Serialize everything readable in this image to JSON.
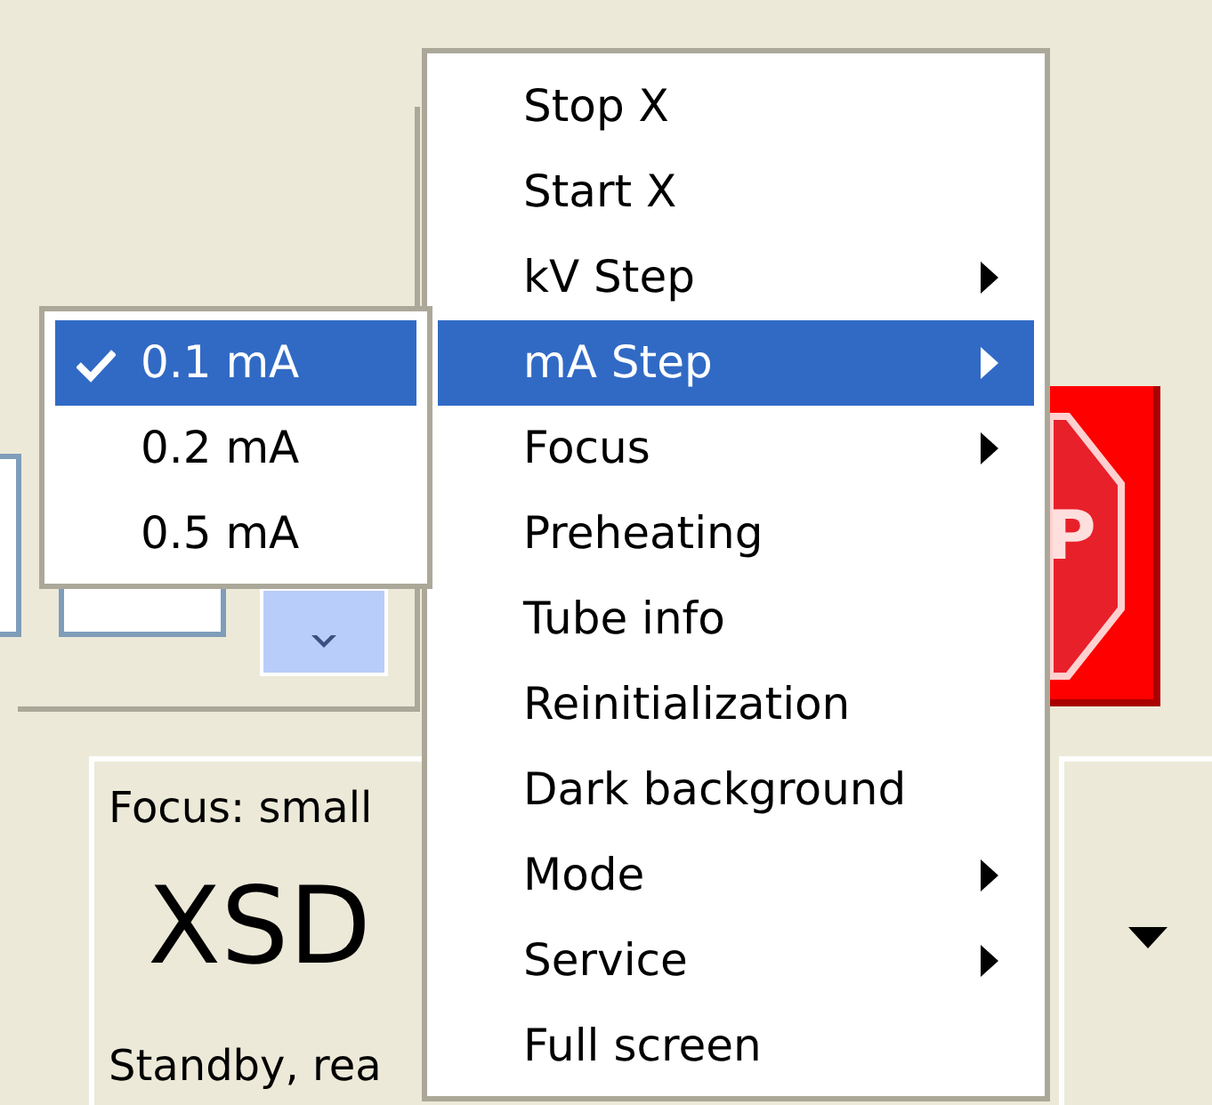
{
  "stop_button": {
    "label": "P"
  },
  "status_panel": {
    "focus": "Focus: small",
    "device": "XSD",
    "status": "Standby, rea"
  },
  "menu": {
    "items": [
      {
        "label": "Stop X",
        "submenu": false,
        "selected": false
      },
      {
        "label": "Start X",
        "submenu": false,
        "selected": false
      },
      {
        "label": "kV Step",
        "submenu": true,
        "selected": false
      },
      {
        "label": "mA Step",
        "submenu": true,
        "selected": true
      },
      {
        "label": "Focus",
        "submenu": true,
        "selected": false
      },
      {
        "label": "Preheating",
        "submenu": false,
        "selected": false
      },
      {
        "label": "Tube info",
        "submenu": false,
        "selected": false
      },
      {
        "label": "Reinitialization",
        "submenu": false,
        "selected": false
      },
      {
        "label": "Dark background",
        "submenu": false,
        "selected": false
      },
      {
        "label": "Mode",
        "submenu": true,
        "selected": false
      },
      {
        "label": "Service",
        "submenu": true,
        "selected": false
      },
      {
        "label": "Full screen",
        "submenu": false,
        "selected": false
      }
    ]
  },
  "submenu": {
    "items": [
      {
        "label": "0.1 mA",
        "checked": true,
        "selected": true
      },
      {
        "label": "0.2 mA",
        "checked": false,
        "selected": false
      },
      {
        "label": "0.5 mA",
        "checked": false,
        "selected": false
      }
    ]
  }
}
